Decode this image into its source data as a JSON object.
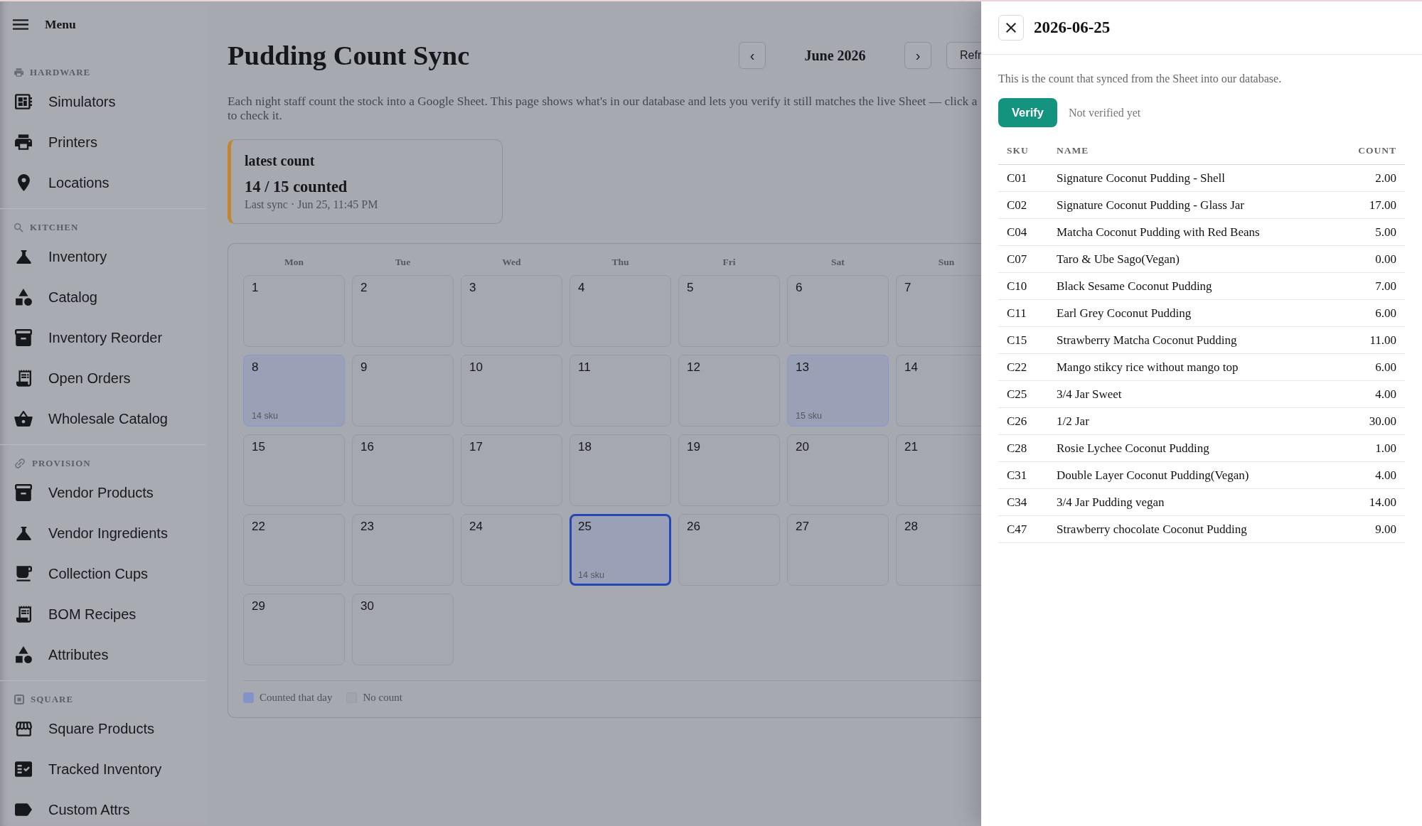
{
  "sidebar": {
    "title": "Menu",
    "sections": [
      {
        "label": "HARDWARE",
        "items": [
          {
            "label": "Simulators"
          },
          {
            "label": "Printers"
          },
          {
            "label": "Locations"
          }
        ]
      },
      {
        "label": "KITCHEN",
        "items": [
          {
            "label": "Inventory"
          },
          {
            "label": "Catalog"
          },
          {
            "label": "Inventory Reorder"
          },
          {
            "label": "Open Orders"
          },
          {
            "label": "Wholesale Catalog"
          }
        ]
      },
      {
        "label": "PROVISION",
        "items": [
          {
            "label": "Vendor Products"
          },
          {
            "label": "Vendor Ingredients"
          },
          {
            "label": "Collection Cups"
          },
          {
            "label": "BOM Recipes"
          },
          {
            "label": "Attributes"
          }
        ]
      },
      {
        "label": "SQUARE",
        "items": [
          {
            "label": "Square Products"
          },
          {
            "label": "Tracked Inventory"
          },
          {
            "label": "Custom Attrs"
          }
        ]
      }
    ]
  },
  "header": {
    "title": "Pudding Count Sync",
    "prev_button": "‹",
    "month": "June 2026",
    "next_button": "›",
    "partial_button": "Refr"
  },
  "description_lines": [
    "Each night staff count the stock into a Google Sheet. This page shows what's in our database and lets you verify it still matches the live Sheet — click a",
    "to check it."
  ],
  "latest_card": {
    "title": "latest count",
    "count": "14 / 15 counted",
    "last_sync": "Last sync · Jun 25, 11:45 PM"
  },
  "calendar": {
    "weekdays": [
      "Mon",
      "Tue",
      "Wed",
      "Thu",
      "Fri",
      "Sat",
      "Sun"
    ],
    "days": [
      {
        "day": "1",
        "counted": false,
        "selected": false
      },
      {
        "day": "2",
        "counted": false,
        "selected": false
      },
      {
        "day": "3",
        "counted": false,
        "selected": false
      },
      {
        "day": "4",
        "counted": false,
        "selected": false
      },
      {
        "day": "5",
        "counted": false,
        "selected": false
      },
      {
        "day": "6",
        "counted": false,
        "selected": false
      },
      {
        "day": "7",
        "counted": false,
        "selected": false
      },
      {
        "day": "8",
        "counted": true,
        "selected": false,
        "sku": "14 sku"
      },
      {
        "day": "9",
        "counted": false,
        "selected": false
      },
      {
        "day": "10",
        "counted": false,
        "selected": false
      },
      {
        "day": "11",
        "counted": false,
        "selected": false
      },
      {
        "day": "12",
        "counted": false,
        "selected": false
      },
      {
        "day": "13",
        "counted": true,
        "selected": false,
        "sku": "15 sku"
      },
      {
        "day": "14",
        "counted": false,
        "selected": false
      },
      {
        "day": "15",
        "counted": false,
        "selected": false
      },
      {
        "day": "16",
        "counted": false,
        "selected": false
      },
      {
        "day": "17",
        "counted": false,
        "selected": false
      },
      {
        "day": "18",
        "counted": false,
        "selected": false
      },
      {
        "day": "19",
        "counted": false,
        "selected": false
      },
      {
        "day": "20",
        "counted": false,
        "selected": false
      },
      {
        "day": "21",
        "counted": false,
        "selected": false
      },
      {
        "day": "22",
        "counted": false,
        "selected": false
      },
      {
        "day": "23",
        "counted": false,
        "selected": false
      },
      {
        "day": "24",
        "counted": false,
        "selected": false
      },
      {
        "day": "25",
        "counted": true,
        "selected": true,
        "sku": "14 sku"
      },
      {
        "day": "26",
        "counted": false,
        "selected": false
      },
      {
        "day": "27",
        "counted": false,
        "selected": false
      },
      {
        "day": "28",
        "counted": false,
        "selected": false
      },
      {
        "day": "29",
        "counted": false,
        "selected": false
      },
      {
        "day": "30",
        "counted": false,
        "selected": false
      }
    ],
    "legend": [
      {
        "kind": "counted",
        "label": "Counted that day"
      },
      {
        "kind": "empty",
        "label": "No count"
      }
    ]
  },
  "drawer": {
    "title": "2026-06-25",
    "note": "This is the count that synced from the Sheet into our database.",
    "verify_button": "Verify",
    "status": "Not verified yet",
    "table": {
      "columns": [
        "SKU",
        "NAME",
        "COUNT"
      ],
      "rows": [
        {
          "sku": "C01",
          "name": "Signature Coconut Pudding - Shell",
          "count": "2.00"
        },
        {
          "sku": "C02",
          "name": "Signature Coconut Pudding - Glass Jar",
          "count": "17.00"
        },
        {
          "sku": "C04",
          "name": "Matcha Coconut Pudding with Red Beans",
          "count": "5.00"
        },
        {
          "sku": "C07",
          "name": "Taro & Ube Sago(Vegan)",
          "count": "0.00"
        },
        {
          "sku": "C10",
          "name": "Black Sesame Coconut Pudding",
          "count": "7.00"
        },
        {
          "sku": "C11",
          "name": "Earl Grey Coconut Pudding",
          "count": "6.00"
        },
        {
          "sku": "C15",
          "name": "Strawberry Matcha Coconut Pudding",
          "count": "11.00"
        },
        {
          "sku": "C22",
          "name": "Mango stikcy rice without mango top",
          "count": "6.00"
        },
        {
          "sku": "C25",
          "name": "3/4 Jar Sweet",
          "count": "4.00"
        },
        {
          "sku": "C26",
          "name": "1/2 Jar",
          "count": "30.00"
        },
        {
          "sku": "C28",
          "name": "Rosie Lychee Coconut Pudding",
          "count": "1.00"
        },
        {
          "sku": "C31",
          "name": "Double Layer Coconut Pudding(Vegan)",
          "count": "4.00"
        },
        {
          "sku": "C34",
          "name": "3/4 Jar Pudding vegan",
          "count": "14.00"
        },
        {
          "sku": "C47",
          "name": "Strawberry chocolate Coconut Pudding",
          "count": "9.00"
        }
      ]
    }
  }
}
